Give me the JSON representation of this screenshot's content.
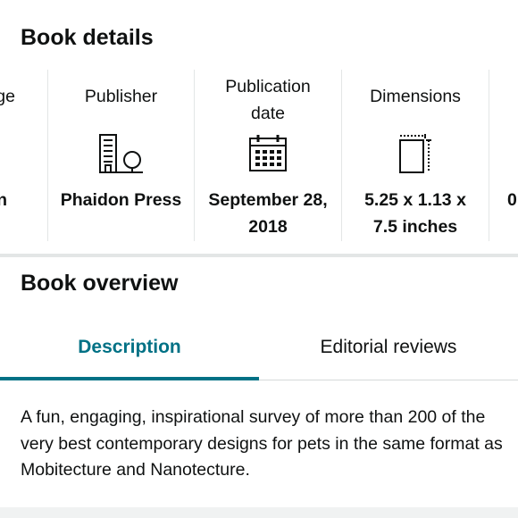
{
  "book_details": {
    "title": "Book details",
    "columns": [
      {
        "label": "ge",
        "icon": "",
        "value": "n"
      },
      {
        "label": "Publisher",
        "icon": "building-tree-icon",
        "value": "Phaidon Press"
      },
      {
        "label": "Publication date",
        "icon": "calendar-icon",
        "value": "September 28, 2018"
      },
      {
        "label": "Dimensions",
        "icon": "dimensions-icon",
        "value": "5.25 x 1.13 x 7.5 inches"
      },
      {
        "label": "",
        "icon": "",
        "value": "0"
      }
    ]
  },
  "book_overview": {
    "title": "Book overview",
    "tabs": [
      {
        "label": "Description",
        "active": true
      },
      {
        "label": "Editorial reviews",
        "active": false
      }
    ],
    "description": "A fun, engaging, inspirational survey of more than 200 of the very best contemporary designs for pets in the same format as Mobitecture and Nanotecture."
  },
  "colors": {
    "accent": "#007185",
    "text": "#0f1111",
    "divider": "#e3e6e6"
  }
}
